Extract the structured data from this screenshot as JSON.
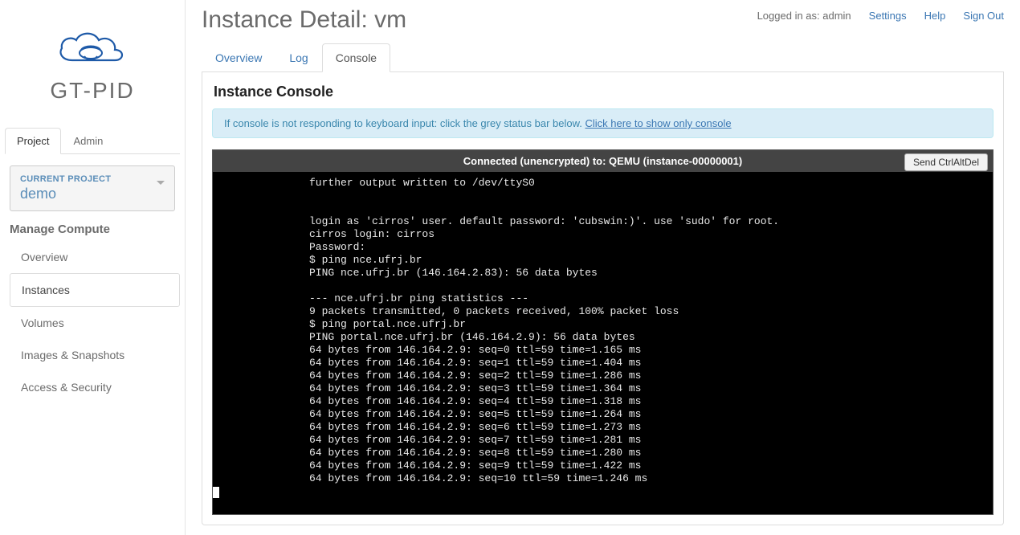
{
  "header": {
    "page_title_prefix": "Instance Detail: ",
    "page_title_name": "vm",
    "logged_in_as": "Logged in as: admin",
    "links": {
      "settings": "Settings",
      "help": "Help",
      "sign_out": "Sign Out"
    }
  },
  "logo": {
    "text": "GT-PID"
  },
  "sidebar": {
    "top_tabs": [
      {
        "label": "Project",
        "active": true
      },
      {
        "label": "Admin",
        "active": false
      }
    ],
    "project_selector": {
      "label": "CURRENT PROJECT",
      "value": "demo"
    },
    "section_title": "Manage Compute",
    "items": [
      {
        "label": "Overview",
        "active": false
      },
      {
        "label": "Instances",
        "active": true
      },
      {
        "label": "Volumes",
        "active": false
      },
      {
        "label": "Images & Snapshots",
        "active": false
      },
      {
        "label": "Access & Security",
        "active": false
      }
    ]
  },
  "tabs": [
    {
      "label": "Overview",
      "active": false
    },
    {
      "label": "Log",
      "active": false
    },
    {
      "label": "Console",
      "active": true
    }
  ],
  "panel": {
    "title": "Instance Console",
    "info_text": "If console is not responding to keyboard input: click the grey status bar below. ",
    "info_link": "Click here to show only console",
    "vnc_status": "Connected (unencrypted) to: QEMU (instance-00000001)",
    "vnc_button": "Send CtrlAltDel",
    "console_lines": [
      "further output written to /dev/ttyS0",
      "",
      "",
      "login as 'cirros' user. default password: 'cubswin:)'. use 'sudo' for root.",
      "cirros login: cirros",
      "Password:",
      "$ ping nce.ufrj.br",
      "PING nce.ufrj.br (146.164.2.83): 56 data bytes",
      "",
      "--- nce.ufrj.br ping statistics ---",
      "9 packets transmitted, 0 packets received, 100% packet loss",
      "$ ping portal.nce.ufrj.br",
      "PING portal.nce.ufrj.br (146.164.2.9): 56 data bytes",
      "64 bytes from 146.164.2.9: seq=0 ttl=59 time=1.165 ms",
      "64 bytes from 146.164.2.9: seq=1 ttl=59 time=1.404 ms",
      "64 bytes from 146.164.2.9: seq=2 ttl=59 time=1.286 ms",
      "64 bytes from 146.164.2.9: seq=3 ttl=59 time=1.364 ms",
      "64 bytes from 146.164.2.9: seq=4 ttl=59 time=1.318 ms",
      "64 bytes from 146.164.2.9: seq=5 ttl=59 time=1.264 ms",
      "64 bytes from 146.164.2.9: seq=6 ttl=59 time=1.273 ms",
      "64 bytes from 146.164.2.9: seq=7 ttl=59 time=1.281 ms",
      "64 bytes from 146.164.2.9: seq=8 ttl=59 time=1.280 ms",
      "64 bytes from 146.164.2.9: seq=9 ttl=59 time=1.422 ms",
      "64 bytes from 146.164.2.9: seq=10 ttl=59 time=1.246 ms"
    ]
  }
}
